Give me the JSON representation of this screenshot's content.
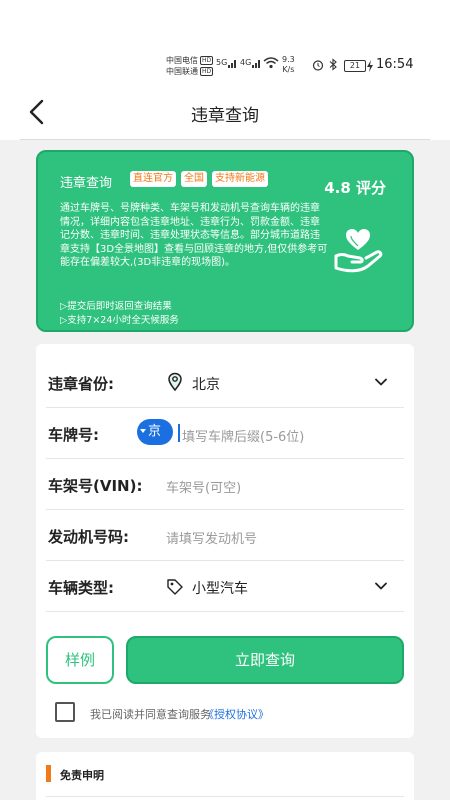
{
  "status_bar": {
    "carrier1": "中国电信",
    "carrier2": "中国联通",
    "hd": "HD",
    "sig1": "5G",
    "sig2": "4G",
    "speed_value": "9.3",
    "speed_unit": "K/s",
    "battery": "21",
    "time": "16:54",
    "alarm_icon": "alarm-icon",
    "bluetooth_icon": "bluetooth-icon"
  },
  "header": {
    "title": "违章查询",
    "back_icon": "chevron-left-icon"
  },
  "banner": {
    "title": "违章查询",
    "tags": [
      "直连官方",
      "全国",
      "支持新能源"
    ],
    "rating": "4.8 评分",
    "description": "通过车牌号、号牌种类、车架号和发动机号查询车辆的违章情况，详细内容包含违章地址、违章行为、罚款金额、违章记分数、违章时间、违章处理状态等信息。部分城市道路违章支持【3D全景地图】查看与回顾违章的地方,但仅供参考可能存在偏差较大,(3D非违章的现场图)。",
    "features": [
      "▷提交后即时返回查询结果",
      "▷支持7×24小时全天候服务"
    ],
    "icon": "hand-heart-icon"
  },
  "form": {
    "province_label": "违章省份:",
    "province_value": "北京",
    "plate_label": "车牌号:",
    "plate_prefix": "京",
    "plate_placeholder": "填写车牌后缀(5-6位)",
    "vin_label": "车架号(VIN):",
    "vin_placeholder": "车架号(可空)",
    "engine_label": "发动机号码:",
    "engine_placeholder": "请填写发动机号",
    "vehicle_label": "车辆类型:",
    "vehicle_value": "小型汽车",
    "sample_button": "样例",
    "query_button": "立即查询",
    "agree_text": "我已阅读并同意查询服务",
    "agree_link": "《授权协议》"
  },
  "disclaimer": {
    "title": "免责申明"
  },
  "colors": {
    "accent": "#2ec27e",
    "tag_text": "#f07a1a",
    "link": "#1c6fe0"
  }
}
